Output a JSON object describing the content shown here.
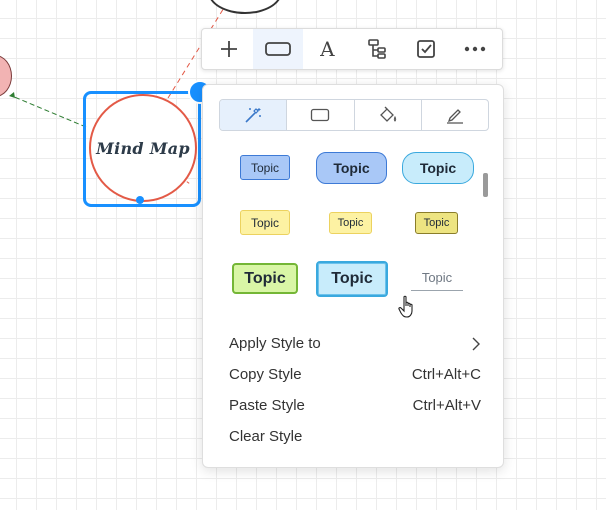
{
  "canvas": {
    "center_topic": "Mind Map"
  },
  "toolbar": {
    "buttons": [
      {
        "name": "add",
        "icon": "plus-icon"
      },
      {
        "name": "shape",
        "icon": "rectangle-icon",
        "active": true
      },
      {
        "name": "text",
        "icon": "font-icon",
        "glyph": "A"
      },
      {
        "name": "structure",
        "icon": "structure-tree-icon"
      },
      {
        "name": "task",
        "icon": "checkbox-icon"
      },
      {
        "name": "more",
        "icon": "more-horizontal-icon"
      }
    ]
  },
  "style_panel": {
    "tabs": [
      {
        "name": "style",
        "icon": "magic-wand-icon",
        "active": true
      },
      {
        "name": "shape",
        "icon": "rectangle-icon"
      },
      {
        "name": "fill",
        "icon": "paint-bucket-icon"
      },
      {
        "name": "border",
        "icon": "pencil-icon"
      }
    ],
    "topic_styles": [
      {
        "label": "Topic"
      },
      {
        "label": "Topic"
      },
      {
        "label": "Topic"
      },
      {
        "label": "Topic"
      },
      {
        "label": "Topic"
      },
      {
        "label": "Topic"
      },
      {
        "label": "Topic"
      },
      {
        "label": "Topic"
      },
      {
        "label": "Topic"
      }
    ],
    "menu": [
      {
        "label": "Apply Style to",
        "shortcut": "",
        "has_submenu": true
      },
      {
        "label": "Copy Style",
        "shortcut": "Ctrl+Alt+C"
      },
      {
        "label": "Paste Style",
        "shortcut": "Ctrl+Alt+V"
      },
      {
        "label": "Clear Style",
        "shortcut": ""
      }
    ]
  },
  "colors": {
    "accent": "#1890ff",
    "node_border": "#e35a47",
    "connector": "#e35a47",
    "left_connector": "#2e7d32"
  }
}
